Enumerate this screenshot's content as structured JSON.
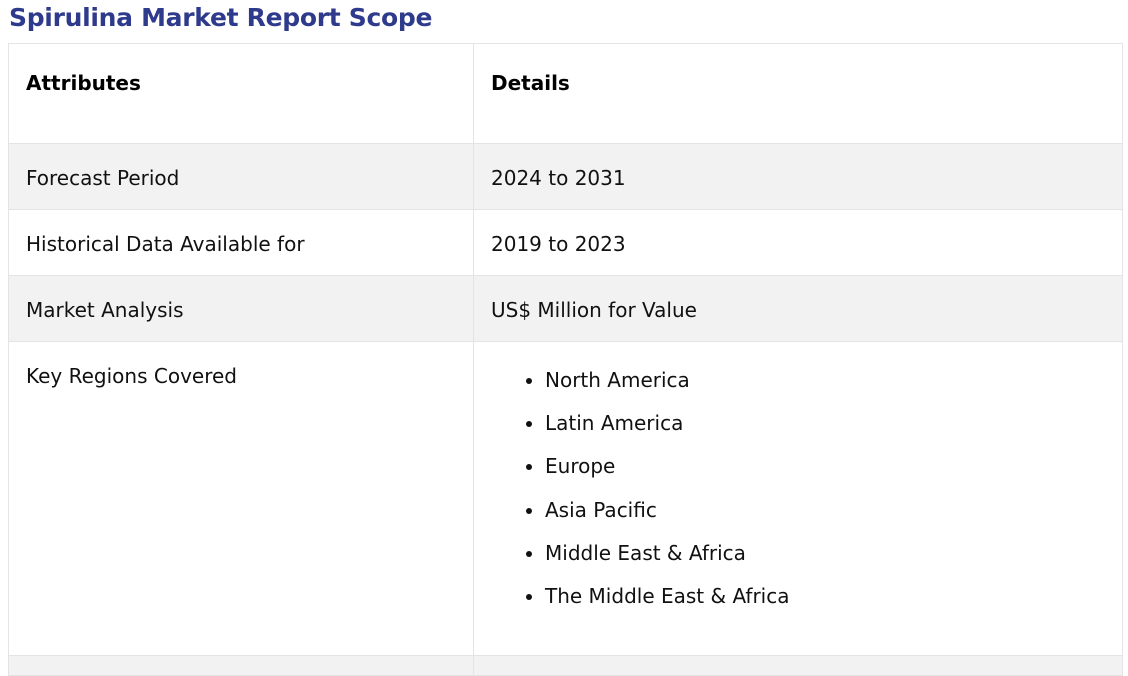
{
  "page": {
    "title": "Spirulina Market Report Scope"
  },
  "table": {
    "headers": {
      "attributes": "Attributes",
      "details": "Details"
    },
    "rows": [
      {
        "attribute": "Forecast Period",
        "detail": "2024 to 2031"
      },
      {
        "attribute": "Historical Data Available for",
        "detail": "2019 to 2023"
      },
      {
        "attribute": "Market Analysis",
        "detail": "US$ Million for Value"
      }
    ],
    "regions": {
      "attribute": "Key Regions Covered",
      "items": [
        "North America",
        "Latin America",
        "Europe",
        "Asia Pacific",
        "Middle East & Africa",
        "The Middle East & Africa"
      ]
    }
  },
  "colors": {
    "title": "#2e3a8c",
    "shaded_row": "#f2f2f2",
    "border": "#e4e4e4"
  }
}
